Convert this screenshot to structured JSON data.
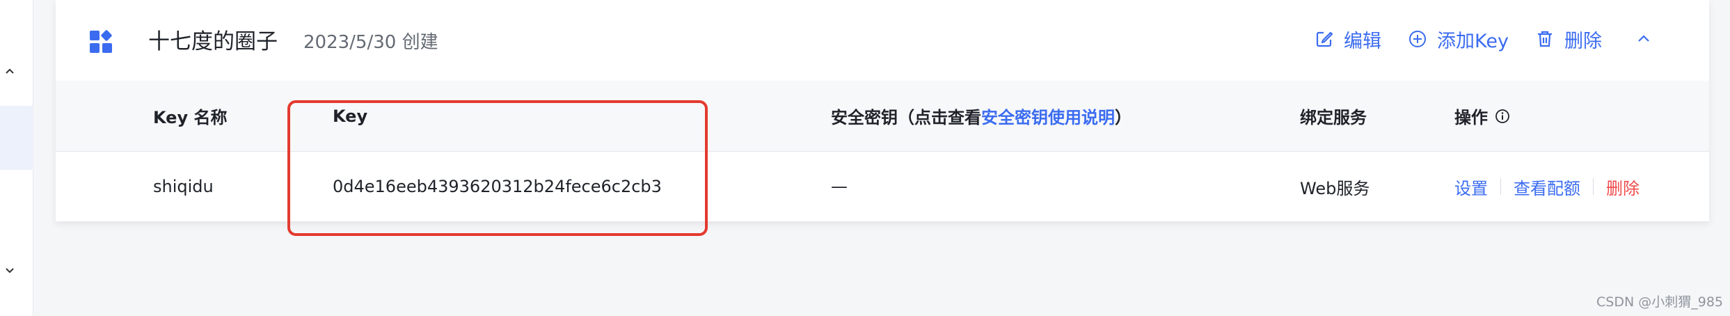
{
  "card": {
    "title": "十七度的圈子",
    "created": "2023/5/30 创建",
    "actions": {
      "edit": "编辑",
      "add_key": "添加Key",
      "delete": "删除"
    }
  },
  "table": {
    "headers": {
      "key_name": "Key 名称",
      "key": "Key",
      "security_prefix": "安全密钥（点击查看",
      "security_link": "安全密钥使用说明",
      "security_suffix": "）",
      "bind_service": "绑定服务",
      "operation": "操作"
    },
    "rows": [
      {
        "key_name": "shiqidu",
        "key": "0d4e16eeb4393620312b24fece6c2cb3",
        "security_key": "—",
        "bind_service": "Web服务",
        "ops": {
          "settings": "设置",
          "quota": "查看配额",
          "delete": "删除"
        }
      }
    ]
  },
  "watermark": "CSDN @小刺猬_985",
  "colors": {
    "accent": "#3b6cf0",
    "danger": "#f04a4a",
    "highlight": "#e33a2f"
  }
}
